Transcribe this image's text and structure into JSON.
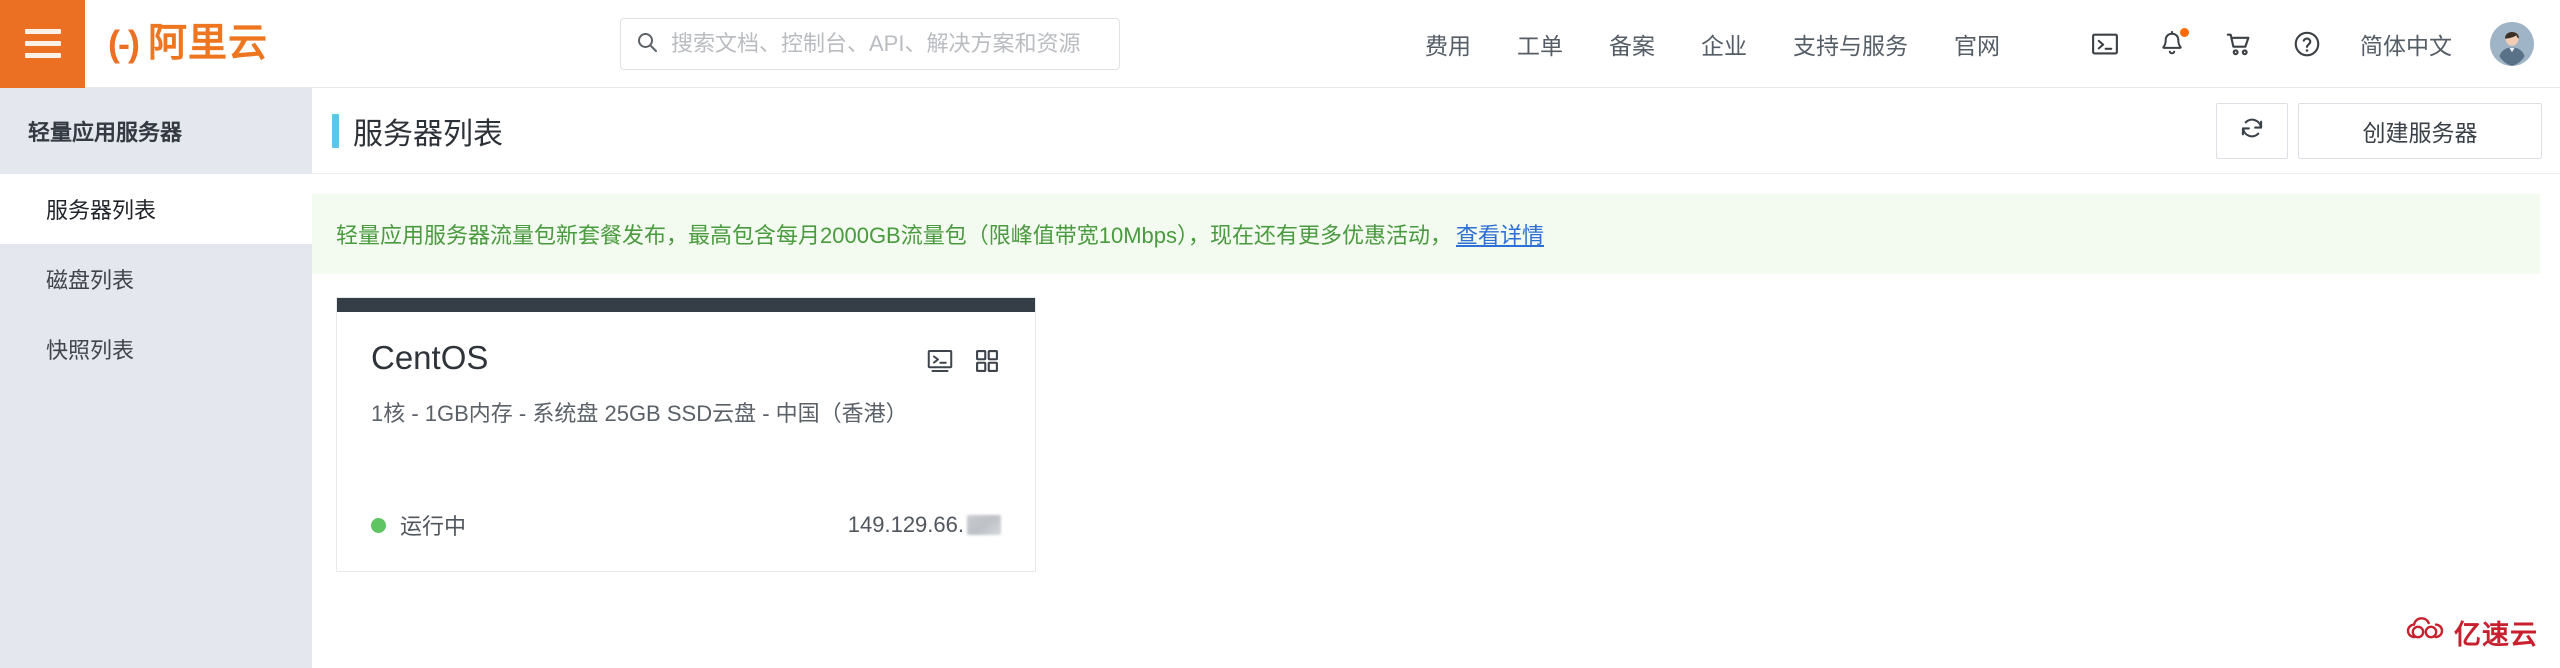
{
  "header": {
    "menu_icon": "hamburger-icon",
    "logo_mark": "(-)",
    "logo_text": "阿里云",
    "search": {
      "icon": "search-icon",
      "placeholder": "搜索文档、控制台、API、解决方案和资源",
      "value": ""
    },
    "nav": [
      {
        "label": "费用"
      },
      {
        "label": "工单"
      },
      {
        "label": "备案"
      },
      {
        "label": "企业"
      },
      {
        "label": "支持与服务"
      },
      {
        "label": "官网"
      }
    ],
    "icons": [
      {
        "name": "terminal-icon"
      },
      {
        "name": "bell-icon",
        "has_badge": true
      },
      {
        "name": "cart-icon"
      },
      {
        "name": "help-icon"
      }
    ],
    "language": "简体中文",
    "avatar": "user-avatar"
  },
  "sidebar": {
    "title": "轻量应用服务器",
    "items": [
      {
        "label": "服务器列表",
        "active": true
      },
      {
        "label": "磁盘列表",
        "active": false
      },
      {
        "label": "快照列表",
        "active": false
      }
    ]
  },
  "page": {
    "title": "服务器列表",
    "accent_color": "#5bc6e8",
    "refresh_label": "refresh-icon",
    "create_label": "创建服务器"
  },
  "notice": {
    "text": "轻量应用服务器流量包新套餐发布，最高包含每月2000GB流量包（限峰值带宽10Mbps），现在还有更多优惠活动，",
    "link": "查看详情",
    "bg_color": "#f3faef",
    "text_color": "#4a9a3f",
    "link_color": "#2d6fd6"
  },
  "servers": [
    {
      "os": "CentOS",
      "spec": "1核 - 1GB内存 - 系统盘 25GB SSD云盘 - 中国（香港）",
      "status": "运行中",
      "status_color": "#5fc462",
      "ip": "149.129.66.",
      "ip_masked": true,
      "icons": [
        {
          "name": "terminal-icon"
        },
        {
          "name": "grid-apps-icon"
        }
      ]
    }
  ],
  "watermark": {
    "text": "亿速云",
    "color": "#c8202f"
  }
}
